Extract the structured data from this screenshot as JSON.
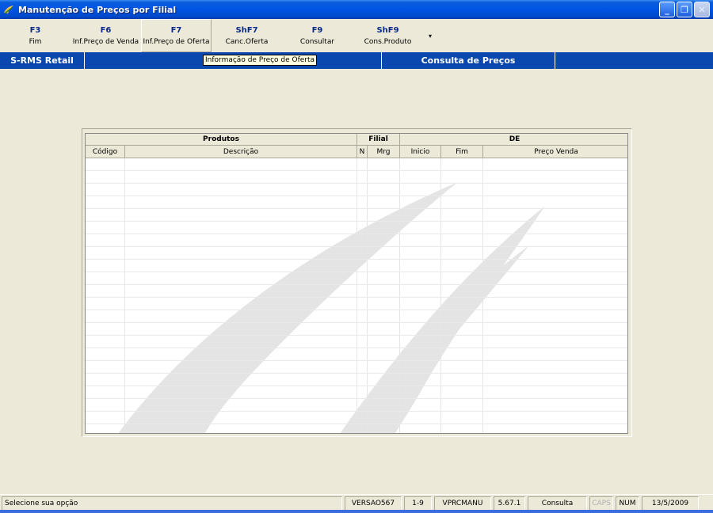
{
  "window": {
    "title": "Manutenção de Preços por Filial"
  },
  "toolbar": {
    "buttons": [
      {
        "key": "F3",
        "label": "Fim"
      },
      {
        "key": "F6",
        "label": "Inf.Preço de Venda"
      },
      {
        "key": "F7",
        "label": "Inf.Preço de Oferta"
      },
      {
        "key": "ShF7",
        "label": "Canc.Oferta"
      },
      {
        "key": "F9",
        "label": "Consultar"
      },
      {
        "key": "ShF9",
        "label": "Cons.Produto"
      }
    ],
    "more": "▾"
  },
  "bluebar": {
    "brand": "S-RMS Retail",
    "section": "Consulta de Preços",
    "tooltip": "Informação de Preço de Oferta"
  },
  "grid": {
    "groups": [
      "Produtos",
      "Filial",
      "DE"
    ],
    "columns": [
      "Código",
      "Descrição",
      "N",
      "Mrg",
      "Inicio",
      "Fim",
      "Preço Venda"
    ]
  },
  "status": {
    "message": "Selecione sua opção",
    "version": "VERSAO567",
    "page": "1-9",
    "program": "VPRCMANU",
    "build": "5.67.1",
    "mode": "Consulta",
    "caps": "CAPS",
    "num": "NUM",
    "date": "13/5/2009"
  },
  "colors": {
    "titlebar": "#0054e3",
    "bluebar": "#0a48b0",
    "toolbar_key": "#0a2a8a",
    "background": "#ece9d8"
  }
}
